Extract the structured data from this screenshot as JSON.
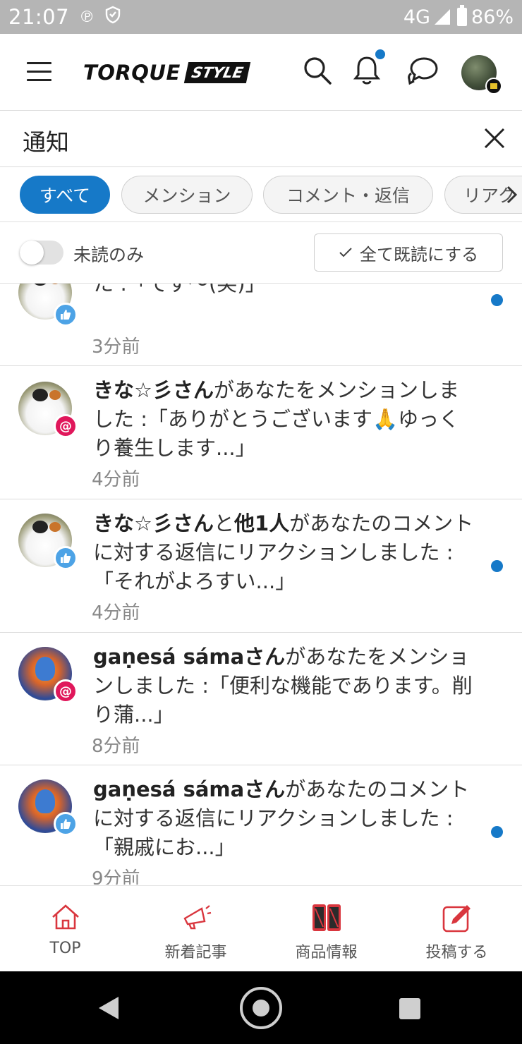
{
  "status_bar": {
    "time": "21:07",
    "network": "4G",
    "battery": "86%"
  },
  "header": {
    "logo_main": "TORQUE",
    "logo_sub": "STYLE",
    "has_unread_notification": true
  },
  "page": {
    "title": "通知"
  },
  "tabs": [
    {
      "label": "すべて",
      "active": true
    },
    {
      "label": "メンション",
      "active": false
    },
    {
      "label": "コメント・返信",
      "active": false
    },
    {
      "label": "リアク",
      "active": false
    }
  ],
  "filter": {
    "unread_only_label": "未読のみ",
    "unread_only_on": false,
    "mark_all_read_label": "全て既読にする"
  },
  "notifications": [
    {
      "actor": "",
      "suffix": "ントに対する返信にリアクションしました :「でず〜(笑)」",
      "time": "3分前",
      "type": "like",
      "unread": true
    },
    {
      "actor": "きな☆彡さん",
      "suffix": "があなたをメンションしました :「ありがとうございます🙏ゆっくり養生します...」",
      "time": "4分前",
      "type": "mention",
      "unread": false
    },
    {
      "actor": "きな☆彡さん",
      "middle": "と",
      "actor2": "他1人",
      "suffix": "があなたのコメントに対する返信にリアクションしました :「それがよろすい...」",
      "time": "4分前",
      "type": "like",
      "unread": true
    },
    {
      "actor": "gaṇesá sámaさん",
      "suffix": "があなたをメンションしました :「便利な機能であります。削り蒲...」",
      "time": "8分前",
      "type": "mention",
      "unread": false
    },
    {
      "actor": "gaṇesá sámaさん",
      "suffix": "があなたのコメントに対する返信にリアクションしました :「親戚にお...」",
      "time": "9分前",
      "type": "like",
      "unread": true
    }
  ],
  "bottom_nav": [
    {
      "label": "TOP",
      "icon": "home-icon"
    },
    {
      "label": "新着記事",
      "icon": "megaphone-icon"
    },
    {
      "label": "商品情報",
      "icon": "phone-product-icon"
    },
    {
      "label": "投稿する",
      "icon": "compose-icon"
    }
  ],
  "colors": {
    "accent": "#1679c8",
    "brand_red": "#d9363e",
    "mention": "#e0175b",
    "like": "#4da3e6"
  }
}
